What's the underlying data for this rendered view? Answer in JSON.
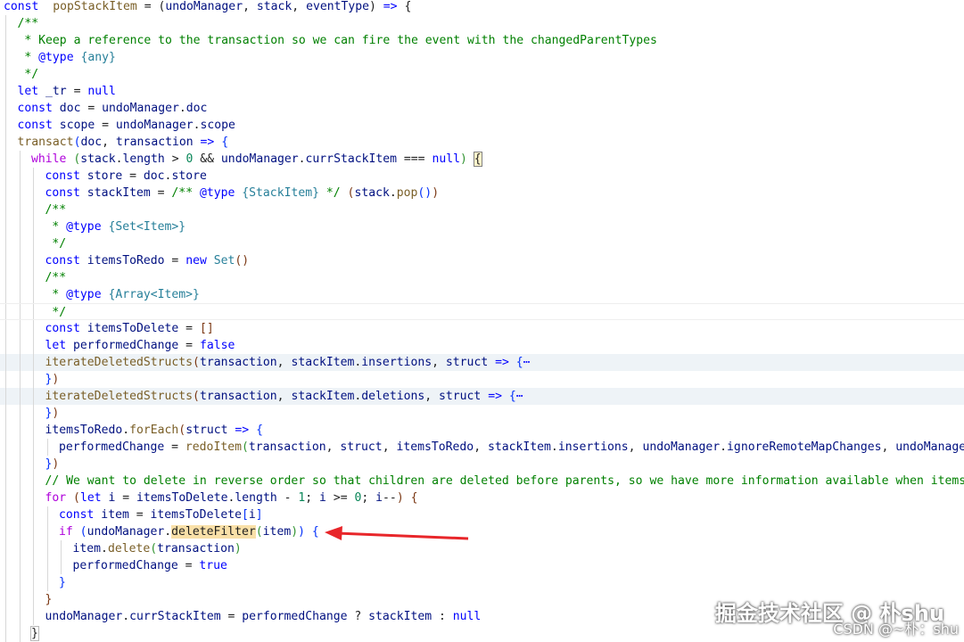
{
  "editor": {
    "lines": [
      {
        "indent": 0,
        "tokens": [
          [
            "k",
            "const"
          ],
          [
            "",
            "  "
          ],
          [
            "f",
            "popStackItem"
          ],
          [
            "",
            " = ("
          ],
          [
            "v",
            "undoManager"
          ],
          [
            "",
            ", "
          ],
          [
            "v",
            "stack"
          ],
          [
            "",
            ", "
          ],
          [
            "v",
            "eventType"
          ],
          [
            "",
            ") "
          ],
          [
            "k",
            "=>"
          ],
          [
            "",
            " {"
          ]
        ]
      },
      {
        "indent": 1,
        "tokens": [
          [
            "c",
            "/**"
          ]
        ]
      },
      {
        "indent": 1,
        "tokens": [
          [
            "c",
            " * Keep a reference to the transaction so we can fire the event with the changedParentTypes"
          ]
        ]
      },
      {
        "indent": 1,
        "tokens": [
          [
            "c",
            " * "
          ],
          [
            "k",
            "@type"
          ],
          [
            "t",
            " {any}"
          ]
        ]
      },
      {
        "indent": 1,
        "tokens": [
          [
            "c",
            " */"
          ]
        ]
      },
      {
        "indent": 1,
        "tokens": [
          [
            "k",
            "let"
          ],
          [
            "",
            ""
          ],
          [
            "v",
            " _tr"
          ],
          [
            "",
            " = "
          ],
          [
            "k",
            "null"
          ]
        ]
      },
      {
        "indent": 1,
        "tokens": [
          [
            "k",
            "const"
          ],
          [
            "v",
            " doc"
          ],
          [
            "",
            " = "
          ],
          [
            "v",
            "undoManager"
          ],
          [
            "",
            "."
          ],
          [
            "v",
            "doc"
          ]
        ]
      },
      {
        "indent": 1,
        "tokens": [
          [
            "k",
            "const"
          ],
          [
            "v",
            " scope"
          ],
          [
            "",
            " = "
          ],
          [
            "v",
            "undoManager"
          ],
          [
            "",
            "."
          ],
          [
            "v",
            "scope"
          ]
        ]
      },
      {
        "indent": 1,
        "tokens": [
          [
            "f",
            "transact"
          ],
          [
            "b1",
            "("
          ],
          [
            "v",
            "doc"
          ],
          [
            "",
            ", "
          ],
          [
            "v",
            "transaction"
          ],
          [
            "",
            " "
          ],
          [
            "k",
            "=>"
          ],
          [
            "",
            " "
          ],
          [
            "b1",
            "{"
          ]
        ]
      },
      {
        "indent": 2,
        "tokens": [
          [
            "kc",
            "while"
          ],
          [
            "",
            " "
          ],
          [
            "b2",
            "("
          ],
          [
            "v",
            "stack"
          ],
          [
            "",
            "."
          ],
          [
            "v",
            "length"
          ],
          [
            "",
            " > "
          ],
          [
            "n",
            "0"
          ],
          [
            "",
            " && "
          ],
          [
            "v",
            "undoManager"
          ],
          [
            "",
            "."
          ],
          [
            "v",
            "currStackItem"
          ],
          [
            "",
            " === "
          ],
          [
            "k",
            "null"
          ],
          [
            "b2",
            ")"
          ],
          [
            "",
            " "
          ],
          [
            "bmx",
            "{"
          ]
        ]
      },
      {
        "indent": 3,
        "tokens": [
          [
            "k",
            "const"
          ],
          [
            "v",
            " store"
          ],
          [
            "",
            " = "
          ],
          [
            "v",
            "doc"
          ],
          [
            "",
            "."
          ],
          [
            "v",
            "store"
          ]
        ]
      },
      {
        "indent": 3,
        "tokens": [
          [
            "k",
            "const"
          ],
          [
            "v",
            " stackItem"
          ],
          [
            "",
            " = "
          ],
          [
            "c",
            "/** "
          ],
          [
            "k",
            "@type"
          ],
          [
            "t",
            " {StackItem}"
          ],
          [
            "c",
            " */"
          ],
          [
            "",
            " "
          ],
          [
            "b3",
            "("
          ],
          [
            "v",
            "stack"
          ],
          [
            "",
            "."
          ],
          [
            "f",
            "pop"
          ],
          [
            "b1",
            "()"
          ],
          [
            "b3",
            ")"
          ]
        ]
      },
      {
        "indent": 3,
        "tokens": [
          [
            "c",
            "/**"
          ]
        ]
      },
      {
        "indent": 3,
        "tokens": [
          [
            "c",
            " * "
          ],
          [
            "k",
            "@type"
          ],
          [
            "t",
            " {Set<Item>}"
          ]
        ]
      },
      {
        "indent": 3,
        "tokens": [
          [
            "c",
            " */"
          ]
        ]
      },
      {
        "indent": 3,
        "tokens": [
          [
            "k",
            "const"
          ],
          [
            "v",
            " itemsToRedo"
          ],
          [
            "",
            " = "
          ],
          [
            "k",
            "new"
          ],
          [
            "",
            " "
          ],
          [
            "t",
            "Set"
          ],
          [
            "b3",
            "()"
          ]
        ]
      },
      {
        "indent": 3,
        "tokens": [
          [
            "c",
            "/**"
          ]
        ]
      },
      {
        "indent": 3,
        "tokens": [
          [
            "c",
            " * "
          ],
          [
            "k",
            "@type"
          ],
          [
            "t",
            " {Array<Item>}"
          ]
        ]
      },
      {
        "indent": 3,
        "cur": true,
        "tokens": [
          [
            "c",
            " */"
          ]
        ]
      },
      {
        "indent": 3,
        "tokens": [
          [
            "k",
            "const"
          ],
          [
            "v",
            " itemsToDelete"
          ],
          [
            "",
            " = "
          ],
          [
            "b3",
            "[]"
          ]
        ]
      },
      {
        "indent": 3,
        "tokens": [
          [
            "k",
            "let"
          ],
          [
            "v",
            " performedChange"
          ],
          [
            "",
            " = "
          ],
          [
            "k",
            "false"
          ]
        ]
      },
      {
        "indent": 3,
        "hl": true,
        "tokens": [
          [
            "f",
            "iterateDeletedStructs"
          ],
          [
            "b3",
            "("
          ],
          [
            "v",
            "transaction"
          ],
          [
            "",
            ", "
          ],
          [
            "v",
            "stackItem"
          ],
          [
            "",
            "."
          ],
          [
            "v",
            "insertions"
          ],
          [
            "",
            ", "
          ],
          [
            "v",
            "struct"
          ],
          [
            "",
            " "
          ],
          [
            "k",
            "=>"
          ],
          [
            "",
            " "
          ],
          [
            "b1",
            "{"
          ],
          [
            "fold",
            "⋯"
          ]
        ]
      },
      {
        "indent": 3,
        "tokens": [
          [
            "b1",
            "}"
          ],
          [
            "b3",
            ")"
          ]
        ]
      },
      {
        "indent": 3,
        "hl": true,
        "tokens": [
          [
            "f",
            "iterateDeletedStructs"
          ],
          [
            "b3",
            "("
          ],
          [
            "v",
            "transaction"
          ],
          [
            "",
            ", "
          ],
          [
            "v",
            "stackItem"
          ],
          [
            "",
            "."
          ],
          [
            "v",
            "deletions"
          ],
          [
            "",
            ", "
          ],
          [
            "v",
            "struct"
          ],
          [
            "",
            " "
          ],
          [
            "k",
            "=>"
          ],
          [
            "",
            " "
          ],
          [
            "b1",
            "{"
          ],
          [
            "fold",
            "⋯"
          ]
        ]
      },
      {
        "indent": 3,
        "tokens": [
          [
            "b1",
            "}"
          ],
          [
            "b3",
            ")"
          ]
        ]
      },
      {
        "indent": 3,
        "tokens": [
          [
            "v",
            "itemsToRedo"
          ],
          [
            "",
            "."
          ],
          [
            "f",
            "forEach"
          ],
          [
            "b3",
            "("
          ],
          [
            "v",
            "struct"
          ],
          [
            "",
            " "
          ],
          [
            "k",
            "=>"
          ],
          [
            "",
            " "
          ],
          [
            "b1",
            "{"
          ]
        ]
      },
      {
        "indent": 4,
        "tokens": [
          [
            "v",
            "performedChange"
          ],
          [
            "",
            " = "
          ],
          [
            "f",
            "redoItem"
          ],
          [
            "b2",
            "("
          ],
          [
            "v",
            "transaction"
          ],
          [
            "",
            ", "
          ],
          [
            "v",
            "struct"
          ],
          [
            "",
            ", "
          ],
          [
            "v",
            "itemsToRedo"
          ],
          [
            "",
            ", "
          ],
          [
            "v",
            "stackItem"
          ],
          [
            "",
            "."
          ],
          [
            "v",
            "insertions"
          ],
          [
            "",
            ", "
          ],
          [
            "v",
            "undoManager"
          ],
          [
            "",
            "."
          ],
          [
            "v",
            "ignoreRemoteMapChanges"
          ],
          [
            "",
            ", "
          ],
          [
            "v",
            "undoManager"
          ],
          [
            "b2",
            ")"
          ]
        ]
      },
      {
        "indent": 3,
        "tokens": [
          [
            "b1",
            "}"
          ],
          [
            "b3",
            ")"
          ]
        ]
      },
      {
        "indent": 3,
        "tokens": [
          [
            "c",
            "// We want to delete in reverse order so that children are deleted before parents, so we have more information available when items are"
          ]
        ]
      },
      {
        "indent": 3,
        "tokens": [
          [
            "kc",
            "for"
          ],
          [
            "",
            " "
          ],
          [
            "b3",
            "("
          ],
          [
            "k",
            "let"
          ],
          [
            "v",
            " i"
          ],
          [
            "",
            " = "
          ],
          [
            "v",
            "itemsToDelete"
          ],
          [
            "",
            "."
          ],
          [
            "v",
            "length"
          ],
          [
            "",
            " - "
          ],
          [
            "n",
            "1"
          ],
          [
            "",
            "; "
          ],
          [
            "v",
            "i"
          ],
          [
            "",
            " >= "
          ],
          [
            "n",
            "0"
          ],
          [
            "",
            "; "
          ],
          [
            "v",
            "i"
          ],
          [
            "",
            "--"
          ],
          [
            "b3",
            ")"
          ],
          [
            "",
            " "
          ],
          [
            "b3",
            "{"
          ]
        ]
      },
      {
        "indent": 4,
        "tokens": [
          [
            "k",
            "const"
          ],
          [
            "v",
            " item"
          ],
          [
            "",
            " = "
          ],
          [
            "v",
            "itemsToDelete"
          ],
          [
            "b1",
            "["
          ],
          [
            "v",
            "i"
          ],
          [
            "b1",
            "]"
          ]
        ]
      },
      {
        "indent": 4,
        "tokens": [
          [
            "kc",
            "if"
          ],
          [
            "",
            " "
          ],
          [
            "b1",
            "("
          ],
          [
            "v",
            "undoManager"
          ],
          [
            "",
            "."
          ],
          [
            "sel",
            "deleteFilter"
          ],
          [
            "b2",
            "("
          ],
          [
            "v",
            "item"
          ],
          [
            "b2",
            ")"
          ],
          [
            "b1",
            ")"
          ],
          [
            "",
            " "
          ],
          [
            "b1",
            "{"
          ]
        ]
      },
      {
        "indent": 5,
        "tokens": [
          [
            "v",
            "item"
          ],
          [
            "",
            "."
          ],
          [
            "f",
            "delete"
          ],
          [
            "b2",
            "("
          ],
          [
            "v",
            "transaction"
          ],
          [
            "b2",
            ")"
          ]
        ]
      },
      {
        "indent": 5,
        "tokens": [
          [
            "v",
            "performedChange"
          ],
          [
            "",
            " = "
          ],
          [
            "k",
            "true"
          ]
        ]
      },
      {
        "indent": 4,
        "tokens": [
          [
            "b1",
            "}"
          ]
        ]
      },
      {
        "indent": 3,
        "tokens": [
          [
            "b3",
            "}"
          ]
        ]
      },
      {
        "indent": 3,
        "tokens": [
          [
            "v",
            "undoManager"
          ],
          [
            "",
            "."
          ],
          [
            "v",
            "currStackItem"
          ],
          [
            "",
            " = "
          ],
          [
            "v",
            "performedChange"
          ],
          [
            "",
            " ? "
          ],
          [
            "v",
            "stackItem"
          ],
          [
            "",
            " : "
          ],
          [
            "k",
            "null"
          ]
        ]
      },
      {
        "indent": 2,
        "tokens": [
          [
            "bm",
            "}"
          ]
        ]
      }
    ]
  },
  "annotation": {
    "type": "arrow",
    "color": "#e8262a"
  },
  "watermark": {
    "text": "掘金技术社区 @ 朴shu",
    "sub": "CSDN @~朴：shu"
  }
}
